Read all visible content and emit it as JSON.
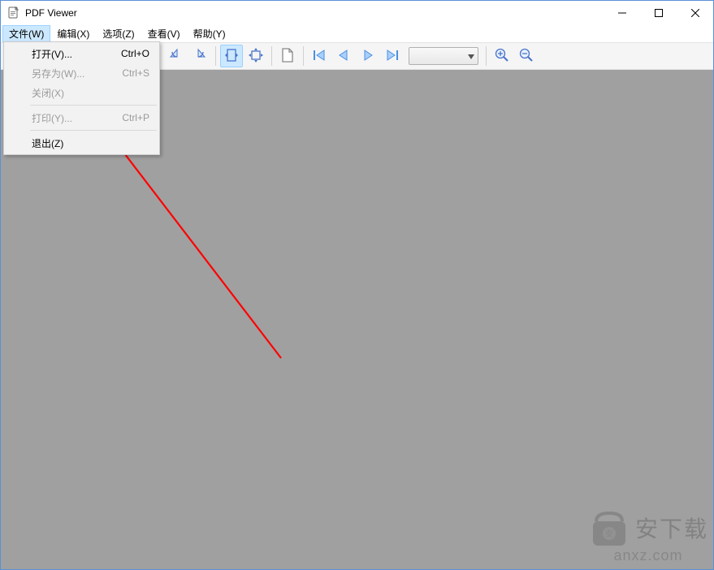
{
  "title": "PDF Viewer",
  "menubar": {
    "file": "文件(W)",
    "edit": "编辑(X)",
    "option": "选项(Z)",
    "view": "查看(V)",
    "help": "帮助(Y)"
  },
  "dropdown": {
    "open": {
      "label": "打开(V)...",
      "shortcut": "Ctrl+O",
      "enabled": true
    },
    "saveas": {
      "label": "另存为(W)...",
      "shortcut": "Ctrl+S",
      "enabled": false
    },
    "close": {
      "label": "关闭(X)",
      "shortcut": "",
      "enabled": false
    },
    "print": {
      "label": "打印(Y)...",
      "shortcut": "Ctrl+P",
      "enabled": false
    },
    "exit": {
      "label": "退出(Z)",
      "shortcut": "",
      "enabled": true
    }
  },
  "toolbar": {
    "rotate_left": "rotate-left",
    "rotate_right": "rotate-right",
    "fit_width": "fit-width",
    "fit_page": "fit-page",
    "single_page": "single-page",
    "nav_first": "first-page",
    "nav_prev": "previous-page",
    "nav_next": "next-page",
    "nav_last": "last-page",
    "page_combo": "",
    "zoom_in": "zoom-in",
    "zoom_out": "zoom-out"
  },
  "watermark": {
    "cn": "安下载",
    "en": "anxz.com"
  },
  "colors": {
    "highlight": "#cce8ff",
    "border_hl": "#99d1ff",
    "content_bg": "#a0a0a0",
    "arrow": "#ff0000"
  }
}
